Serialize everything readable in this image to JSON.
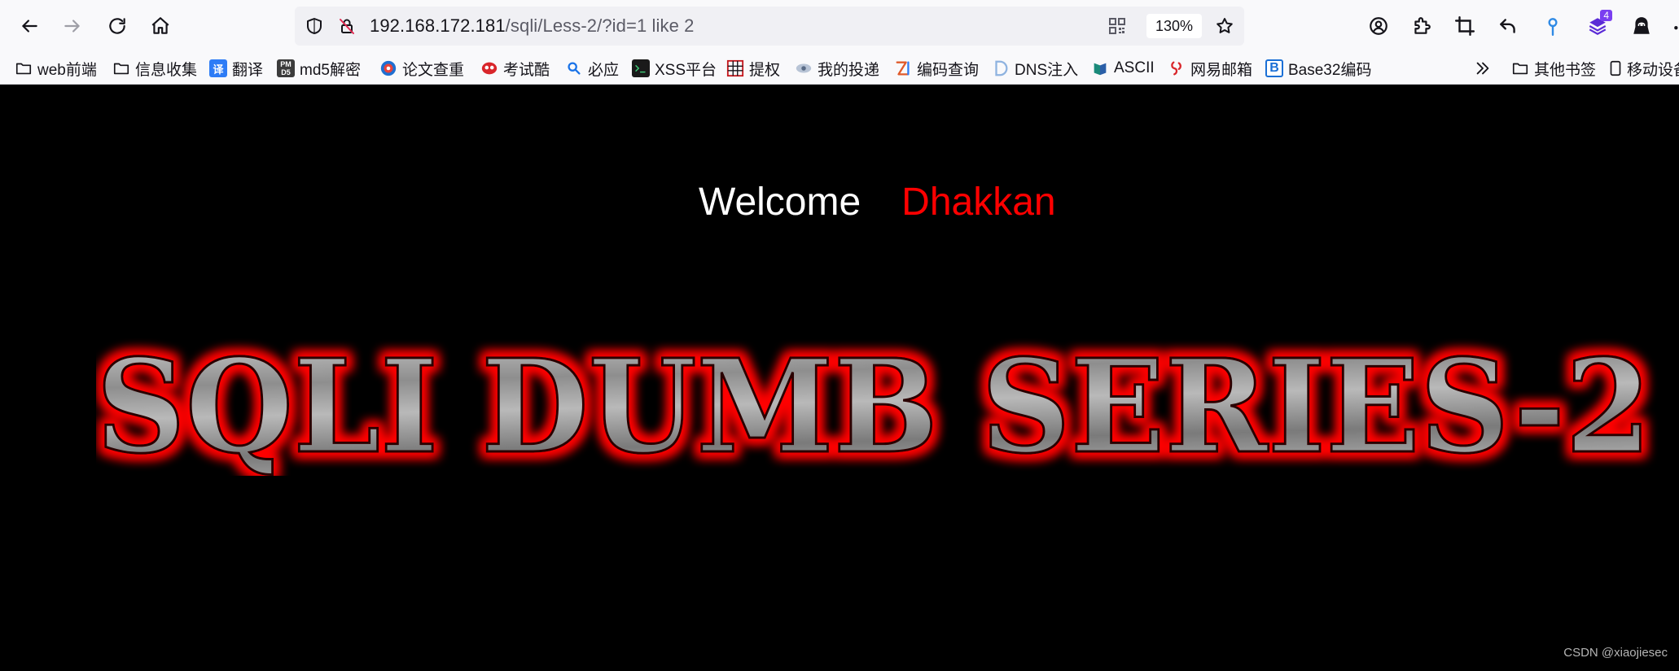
{
  "browser": {
    "address": {
      "host": "192.168.172.181",
      "path": "/sqli/Less-2/?id=1 like 2"
    },
    "zoom_level": "130%",
    "extension_badge_count": "4",
    "icons": {
      "back": "back-arrow-icon",
      "forward": "forward-arrow-icon",
      "reload": "reload-icon",
      "home": "home-icon",
      "shield": "tracking-shield-icon",
      "insecure": "insecure-lock-icon",
      "qr": "qr-code-icon",
      "bookmark_star": "bookmark-star-icon",
      "account": "account-icon",
      "extensions": "extensions-puzzle-icon",
      "screenshot": "crop-icon",
      "undo": "undo-arrow-icon",
      "pin": "location-pin-icon",
      "layers": "layers-extension-icon",
      "hacker": "hacker-extension-icon"
    }
  },
  "bookmarks": {
    "items": [
      {
        "label": "web前端",
        "icon": "folder-icon"
      },
      {
        "label": "信息收集",
        "icon": "folder-icon"
      },
      {
        "label": "翻译",
        "icon": "translate-icon"
      },
      {
        "label": "md5解密",
        "icon": "md5-icon"
      },
      {
        "label": "论文查重",
        "icon": "paper-check-icon"
      },
      {
        "label": "考试酷",
        "icon": "exam-icon"
      },
      {
        "label": "必应",
        "icon": "search-icon"
      },
      {
        "label": "XSS平台",
        "icon": "terminal-icon"
      },
      {
        "label": "提权",
        "icon": "grid-icon"
      },
      {
        "label": "我的投递",
        "icon": "eye-icon"
      },
      {
        "label": "编码查询",
        "icon": "code-z-icon"
      },
      {
        "label": "DNS注入",
        "icon": "dns-icon"
      },
      {
        "label": "ASCII",
        "icon": "ascii-icon"
      },
      {
        "label": "网易邮箱",
        "icon": "netease-mail-icon"
      },
      {
        "label": "Base32编码",
        "icon": "base32-icon"
      }
    ],
    "overflow_icon": "chevron-double-right-icon",
    "other_label": "其他书签",
    "mobile_label": "移动设备"
  },
  "page": {
    "welcome_word": "Welcome",
    "welcome_name": "Dhakkan",
    "banner_text": "SQLI DUMB SERIES-2",
    "watermark": "CSDN @xiaojiesec"
  },
  "colors": {
    "page_background": "#000000",
    "welcome_text": "#ffffff",
    "name_text": "#ff0000",
    "banner_glow": "#ff0000",
    "banner_metal": "#9a9a9a",
    "chrome_background": "#f9f9fb",
    "urlbar_background": "#f0f0f4"
  }
}
